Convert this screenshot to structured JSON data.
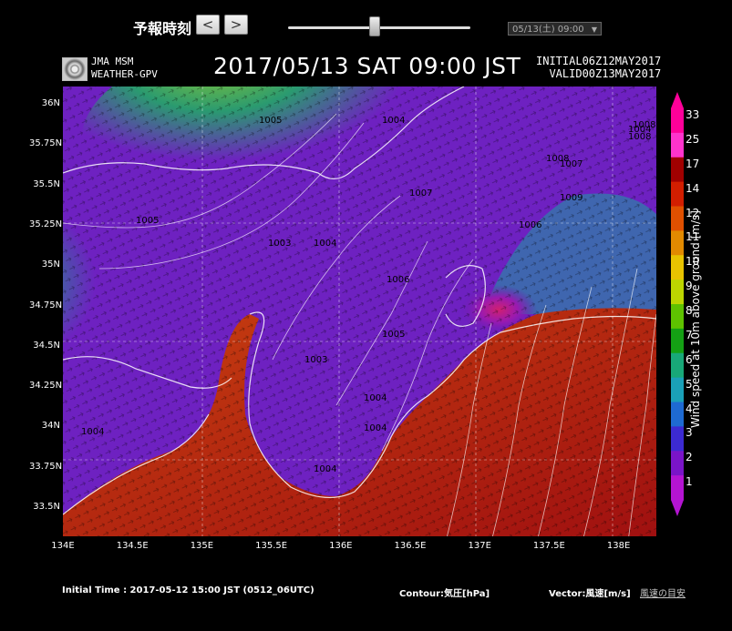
{
  "header": {
    "forecast_label": "予報時刻",
    "prev_label": "<",
    "next_label": ">",
    "slider_value": 0.47,
    "selected_time": "05/13(土) 09:00"
  },
  "title": {
    "model_line1": "JMA MSM",
    "model_line2": "WEATHER-GPV",
    "valid": "2017/05/13  SAT  09:00 JST",
    "initial": "INITIAL06Z12MAY2017",
    "valid_utc": "VALID00Z13MAY2017"
  },
  "map": {
    "lat_ticks": [
      "36N",
      "35.75N",
      "35.5N",
      "35.25N",
      "35N",
      "34.75N",
      "34.5N",
      "34.25N",
      "34N",
      "33.75N",
      "33.5N"
    ],
    "lon_ticks": [
      "134E",
      "134.5E",
      "135E",
      "135.5E",
      "136E",
      "136.5E",
      "137E",
      "137.5E",
      "138E"
    ],
    "isobar_labels": [
      "1005",
      "1004",
      "1004",
      "1005",
      "1003",
      "1004",
      "1006",
      "1005",
      "1003",
      "1004",
      "1004",
      "1004",
      "1004",
      "1007",
      "1006",
      "1008",
      "1007",
      "1009",
      "1008",
      "1008"
    ]
  },
  "colorbar": {
    "labels": [
      "33",
      "25",
      "17",
      "14",
      "12",
      "11",
      "10",
      "9",
      "8",
      "7",
      "6",
      "5",
      "4",
      "3",
      "2",
      "1"
    ],
    "colors": [
      "#ff0099",
      "#ff33cc",
      "#a00000",
      "#d21e00",
      "#e05000",
      "#e28a00",
      "#e8c300",
      "#bcd500",
      "#5ec200",
      "#14a014",
      "#18a878",
      "#1aa0b8",
      "#1e6ad2",
      "#3c2ad2",
      "#7a14c8",
      "#b414d2"
    ],
    "title": "Wind speed at 10m above ground [m/s]"
  },
  "footer": {
    "initial_time": "Initial Time : 2017-05-12 15:00 JST (0512_06UTC)",
    "contour": "Contour:気圧[hPa]",
    "vector": "Vector:風速[m/s]",
    "guide_link": "風速の目安"
  }
}
